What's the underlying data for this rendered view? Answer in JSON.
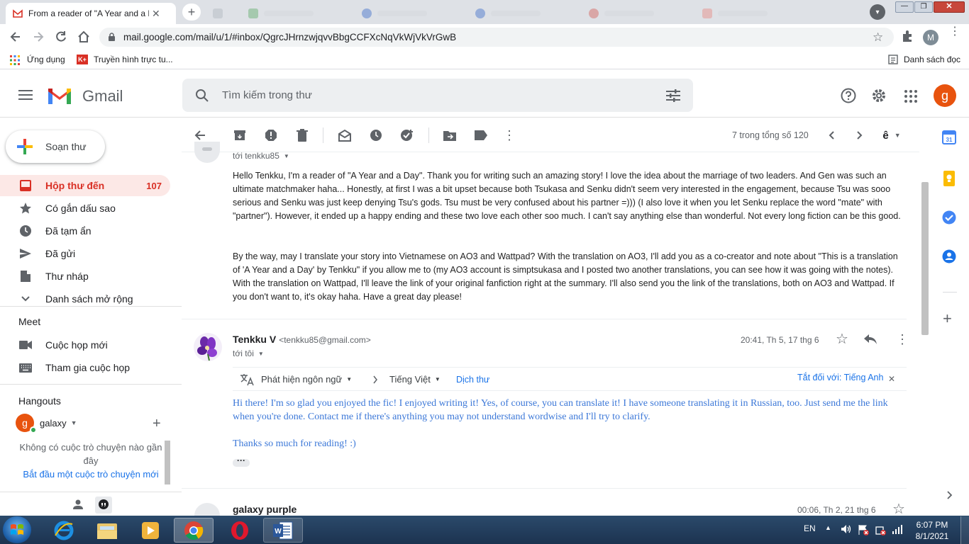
{
  "browser": {
    "active_tab_title": "From a reader of \"A Year and a D",
    "url": "mail.google.com/mail/u/1/#inbox/QgrcJHrnzwjqvvBbgCCFXcNqVkWjVkVrGwB",
    "bookmarks": {
      "apps_label": "Ứng dụng",
      "item1": "Truyền hình trực tu...",
      "reading_list": "Danh sách đọc"
    },
    "profile_initial": "M"
  },
  "gmail": {
    "logo_text": "Gmail",
    "search_placeholder": "Tìm kiếm trong thư",
    "avatar_initial": "g",
    "compose_label": "Soạn thư",
    "nav": [
      {
        "label": "Hộp thư đến",
        "count": "107"
      },
      {
        "label": "Có gắn dấu sao"
      },
      {
        "label": "Đã tạm ẩn"
      },
      {
        "label": "Đã gửi"
      },
      {
        "label": "Thư nháp"
      },
      {
        "label": "Danh sách mở rộng"
      }
    ],
    "meet": {
      "heading": "Meet",
      "new_meeting": "Cuộc họp mới",
      "join_meeting": "Tham gia cuộc họp"
    },
    "hangouts": {
      "heading": "Hangouts",
      "user": "galaxy",
      "user_initial": "g",
      "empty_text": "Không có cuộc trò chuyện nào gần đây",
      "start_link": "Bắt đầu một cuộc trò chuyện mới"
    },
    "toolbar": {
      "pagination": "7 trong tổng số 120"
    },
    "message1": {
      "to_label": "tới tenkku85",
      "paragraph1": "Hello Tenkku, I'm a reader of \"A Year and a Day\". Thank you for writing such an amazing story! I love the idea about the marriage of two leaders. And Gen was such an ultimate matchmaker haha... Honestly, at first I was a bit upset because both Tsukasa and Senku didn't seem very interested in the engagement, because Tsu was sooo serious and Senku was just keep denying Tsu's gods. Tsu must be very confused about his partner =))) (I also love it when you let Senku replace the word \"mate\" with \"partner\"). However, it ended up a happy ending and these two love each other soo much. I can't say anything else than wonderful. Not every long fiction can be this good.",
      "paragraph2": "By the way, may I translate your story into Vietnamese on AO3 and Wattpad? With the translation on AO3, I'll add you as a co-creator and note about \"This is a translation of 'A Year and a Day' by Tenkku\" if you allow me to (my AO3 account is simptsukasa and I posted two another translations, you can see how it was going with the notes). With the translation on Wattpad, I'll leave the link of your original fanfiction right at the summary. I'll also send you the link of the translations, both on AO3 and Wattpad. If you don't want to, it's okay haha. Have a great day please!"
    },
    "message2": {
      "sender_name": "Tenkku V",
      "sender_email": "<tenkku85@gmail.com>",
      "timestamp": "20:41, Th 5, 17 thg 6",
      "to_label": "tới tôi",
      "translate_bar": {
        "detect_language": "Phát hiện ngôn ngữ",
        "target_language": "Tiếng Việt",
        "translate_link": "Dịch thư",
        "turn_off": "Tắt đối với: Tiếng Anh"
      },
      "body1": "Hi there! I'm so glad you enjoyed the fic! I enjoyed writing it! Yes, of course, you can translate it! I have someone translating it in Russian, too. Just send me the link when you're done. Contact me if there's anything you may not understand wordwise and I'll try to clarify.",
      "body2": "Thanks so much for reading! :)"
    },
    "message3": {
      "sender_name": "galaxy purple",
      "timestamp": "00:06, Th 2, 21 thg 6"
    }
  },
  "taskbar": {
    "language": "EN",
    "time": "6:07 PM",
    "date": "8/1/2021"
  },
  "colors": {
    "gmail_red": "#d93025",
    "link_blue": "#1a73e8",
    "translated_text": "#3c78d8",
    "selected_nav_bg": "#fce8e6"
  }
}
